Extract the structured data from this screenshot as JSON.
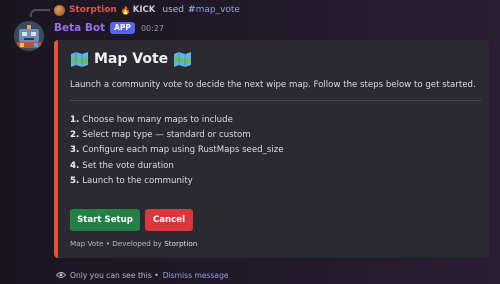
{
  "reply": {
    "user": "Storption",
    "tag": "KICK",
    "used_label": "used",
    "command": "map_vote"
  },
  "message": {
    "bot_name": "Beta Bot",
    "badge": "APP",
    "timestamp": "00:27"
  },
  "embed": {
    "accent_color": "#e8542f",
    "title": "Map Vote",
    "description": "Launch a community vote to decide the next wipe map. Follow the steps below to get started.",
    "steps": [
      {
        "num": "1.",
        "text": "Choose how many maps to include"
      },
      {
        "num": "2.",
        "text": "Select map type — standard or custom"
      },
      {
        "num": "3.",
        "text": "Configure each map using RustMaps seed_size"
      },
      {
        "num": "4.",
        "text": "Set the vote duration"
      },
      {
        "num": "5.",
        "text": "Launch to the community"
      }
    ],
    "buttons": {
      "start": "Start Setup",
      "cancel": "Cancel"
    },
    "footer": {
      "prefix": "Map Vote • Developed by",
      "author": "Storption"
    }
  },
  "ephemeral": {
    "note": "Only you can see this •",
    "dismiss": "Dismiss message"
  }
}
